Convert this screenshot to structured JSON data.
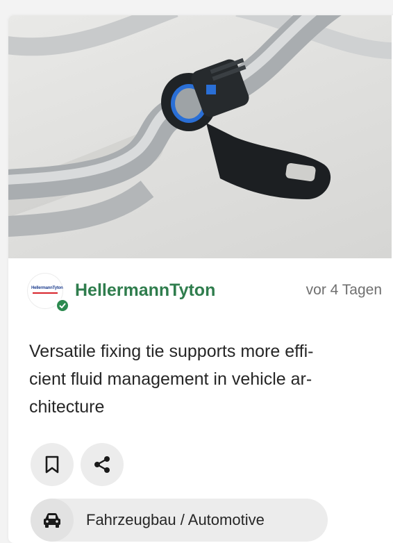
{
  "card": {
    "image_alt": "Black fixing tie clamped on metal fluid pipe",
    "company": {
      "name": "HellermannTyton",
      "logo_text": "HellermannTyton",
      "verified": true
    },
    "posted": "vor 4 Tagen",
    "title": "Versatile fixing tie supports more effi-cient fluid management in vehicle ar-chitecture",
    "title_lines": [
      "Versatile fixing tie supports more effi-",
      "cient fluid management in vehicle ar-",
      "chitecture"
    ],
    "actions": [
      {
        "icon": "bookmark-icon"
      },
      {
        "icon": "share-icon"
      }
    ],
    "category": {
      "icon": "car-icon",
      "label": "Fahrzeugbau / Automotive"
    }
  },
  "colors": {
    "company_name": "#2f7d4d",
    "verified_badge": "#2c8a4f",
    "chip_background": "#ececec",
    "text": "#262626",
    "muted": "#6f6f6f"
  }
}
